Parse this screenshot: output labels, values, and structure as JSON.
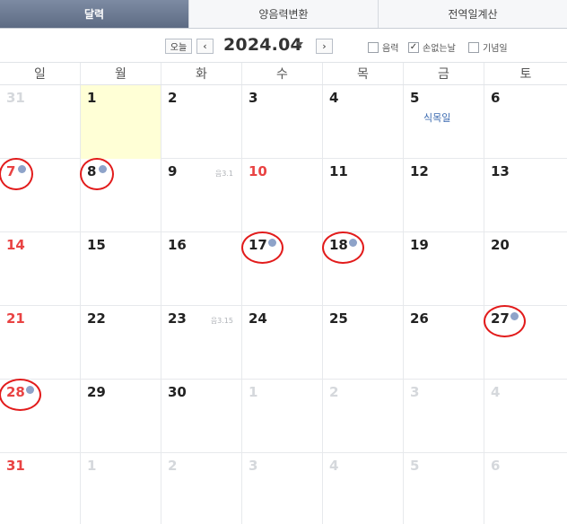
{
  "tabs": [
    {
      "label": "달력",
      "active": true
    },
    {
      "label": "양음력변환",
      "active": false
    },
    {
      "label": "전역일계산",
      "active": false
    }
  ],
  "toolbar": {
    "today_label": "오늘",
    "month_title": "2024.04",
    "options": [
      {
        "label": "음력",
        "checked": false
      },
      {
        "label": "손없는날",
        "checked": true
      },
      {
        "label": "기념일",
        "checked": false
      }
    ]
  },
  "weekdays": [
    "일",
    "월",
    "화",
    "수",
    "목",
    "금",
    "토"
  ],
  "weeks": [
    [
      {
        "n": "31",
        "c": "gray"
      },
      {
        "n": "1",
        "today": true
      },
      {
        "n": "2"
      },
      {
        "n": "3"
      },
      {
        "n": "4"
      },
      {
        "n": "5",
        "holiday": "식목일"
      },
      {
        "n": "6"
      }
    ],
    [
      {
        "n": "7",
        "c": "red",
        "dot": true,
        "circle": true
      },
      {
        "n": "8",
        "dot": true,
        "circle": true
      },
      {
        "n": "9",
        "lunar": "음3.1"
      },
      {
        "n": "10",
        "c": "red"
      },
      {
        "n": "11"
      },
      {
        "n": "12"
      },
      {
        "n": "13"
      }
    ],
    [
      {
        "n": "14",
        "c": "red"
      },
      {
        "n": "15"
      },
      {
        "n": "16"
      },
      {
        "n": "17",
        "dot": true,
        "circle": true
      },
      {
        "n": "18",
        "dot": true,
        "circle": true
      },
      {
        "n": "19"
      },
      {
        "n": "20"
      }
    ],
    [
      {
        "n": "21",
        "c": "red"
      },
      {
        "n": "22"
      },
      {
        "n": "23",
        "lunar": "음3.15"
      },
      {
        "n": "24"
      },
      {
        "n": "25"
      },
      {
        "n": "26"
      },
      {
        "n": "27",
        "dot": true,
        "circle": true
      }
    ],
    [
      {
        "n": "28",
        "c": "red",
        "dot": true,
        "circle": true,
        "selected": true
      },
      {
        "n": "29"
      },
      {
        "n": "30"
      },
      {
        "n": "1",
        "c": "gray"
      },
      {
        "n": "2",
        "c": "gray"
      },
      {
        "n": "3",
        "c": "gray"
      },
      {
        "n": "4",
        "c": "gray"
      }
    ],
    [
      {
        "n": "31",
        "c": "red"
      },
      {
        "n": "1",
        "c": "gray"
      },
      {
        "n": "2",
        "c": "gray"
      },
      {
        "n": "3",
        "c": "gray"
      },
      {
        "n": "4",
        "c": "gray"
      },
      {
        "n": "5",
        "c": "gray"
      },
      {
        "n": "6",
        "c": "gray"
      }
    ]
  ],
  "icons": {
    "prev": "chevron-left-icon",
    "next": "chevron-right-icon",
    "dropdown": "caret-down-icon",
    "dot": "no-loss-day-dot-icon"
  },
  "colors": {
    "tab_active": "#6b7891",
    "weekend_red": "#e94343",
    "today_bg": "#ffffd6",
    "dot": "#8ea3c9",
    "annotation_circle": "#e21b1b",
    "holiday_text": "#3b6ab0"
  }
}
